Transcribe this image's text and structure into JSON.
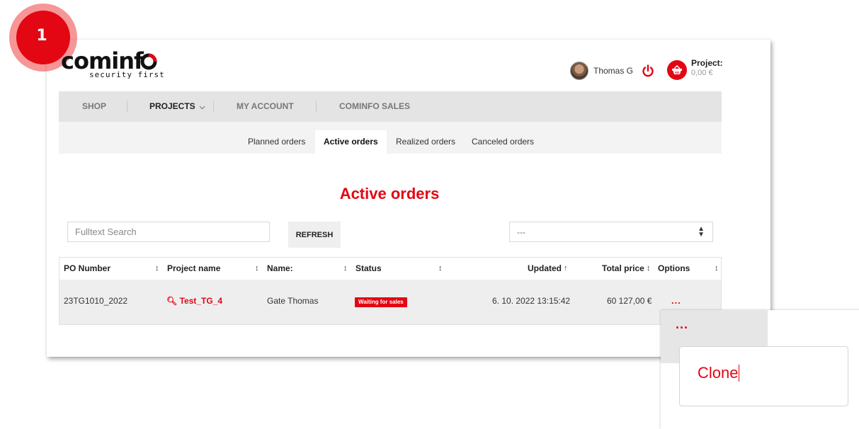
{
  "step_badge": "1",
  "logo": {
    "wordmark": "cominfo",
    "tagline": "security first"
  },
  "header": {
    "user_name": "Thomas G",
    "project_label": "Project:",
    "project_value": "0,00 €"
  },
  "nav": {
    "items": [
      {
        "label": "SHOP"
      },
      {
        "label": "PROJECTS"
      },
      {
        "label": "MY ACCOUNT"
      },
      {
        "label": "COMINFO SALES"
      }
    ],
    "active": "PROJECTS"
  },
  "subnav": {
    "tabs": [
      {
        "label": "Planned orders"
      },
      {
        "label": "Active orders"
      },
      {
        "label": "Realized orders"
      },
      {
        "label": "Canceled orders"
      }
    ],
    "active": "Active orders"
  },
  "page_title": "Active orders",
  "search": {
    "placeholder": "Fulltext Search",
    "value": ""
  },
  "refresh_label": "REFRESH",
  "filter_select": {
    "value": "---"
  },
  "table": {
    "columns": [
      "PO Number",
      "Project name",
      "Name:",
      "Status",
      "Updated",
      "Total price",
      "Options"
    ],
    "sort_column": "Updated",
    "rows": [
      {
        "po_number": "23TG1010_2022",
        "project_name": "Test_TG_4",
        "name": "Gate Thomas",
        "status": "Waiting for sales",
        "updated": "6. 10. 2022 13:15:42",
        "total_price": "60 127,00 €",
        "options": "..."
      }
    ]
  },
  "popover": {
    "trigger": "...",
    "menu_item": "Clone"
  },
  "colors": {
    "brand": "#e30613",
    "nav_bg": "#e4e4e4",
    "row_bg": "#eeeeee"
  }
}
